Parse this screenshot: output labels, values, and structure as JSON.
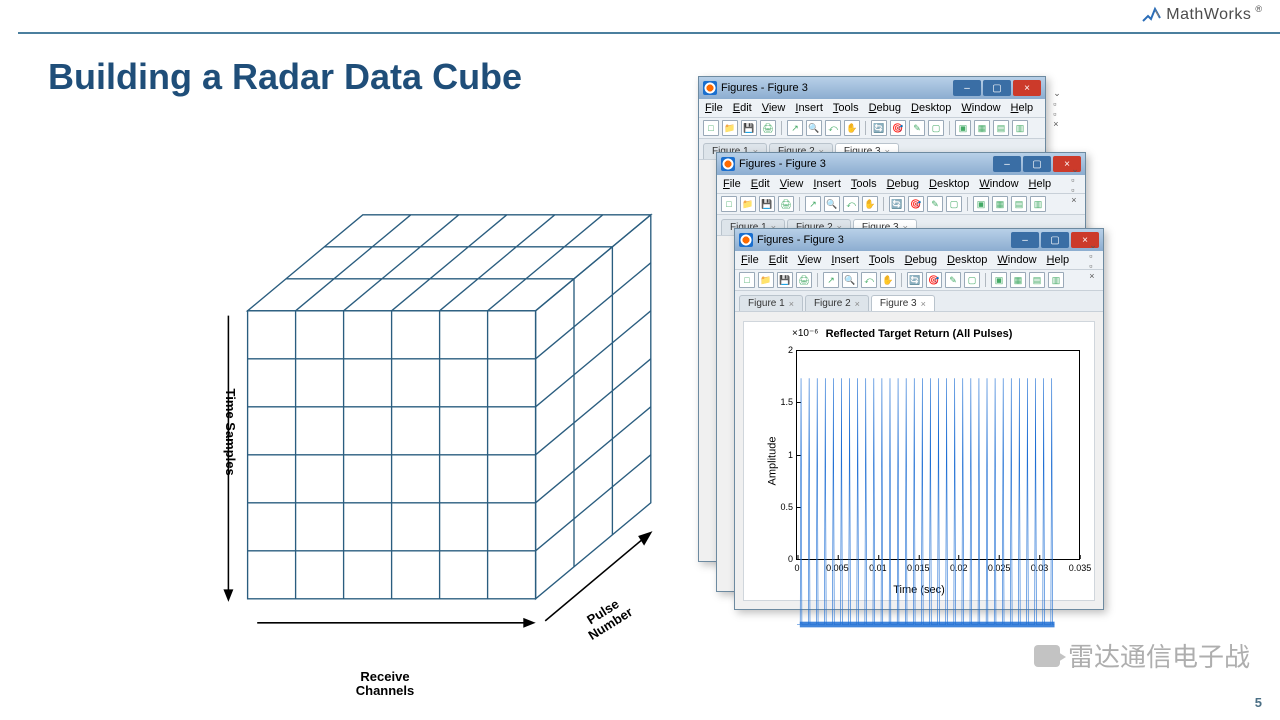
{
  "brand": "MathWorks",
  "title": "Building a Radar Data Cube",
  "page_number": "5",
  "watermark": "雷达通信电子战",
  "cube": {
    "axis_time": "Time Samples",
    "axis_receive": "Receive\nChannels",
    "axis_pulse": "Pulse\nNumber"
  },
  "windows": [
    {
      "title": "Figures - Figure 3"
    },
    {
      "title": "Figures - Figure 3"
    },
    {
      "title": "Figures - Figure 3"
    }
  ],
  "menus": [
    "File",
    "Edit",
    "View",
    "Insert",
    "Tools",
    "Debug",
    "Desktop",
    "Window",
    "Help"
  ],
  "tabs": [
    "Figure 1",
    "Figure 2",
    "Figure 3"
  ],
  "chart_data": {
    "type": "line",
    "title": "Reflected Target Return (All Pulses)",
    "xlabel": "Time (sec)",
    "ylabel": "Amplitude",
    "y_exponent": "×10⁻⁶",
    "xlim": [
      0,
      0.035
    ],
    "ylim": [
      0,
      2
    ],
    "xticks": [
      0,
      0.005,
      0.01,
      0.015,
      0.02,
      0.025,
      0.03,
      0.035
    ],
    "yticks": [
      0,
      0.5,
      1,
      1.5,
      2
    ],
    "n_pulses": 32,
    "pulse_x_start": 0.0005,
    "pulse_x_end": 0.0315,
    "pulse_peak": 1.8,
    "baseline": 0.06
  }
}
